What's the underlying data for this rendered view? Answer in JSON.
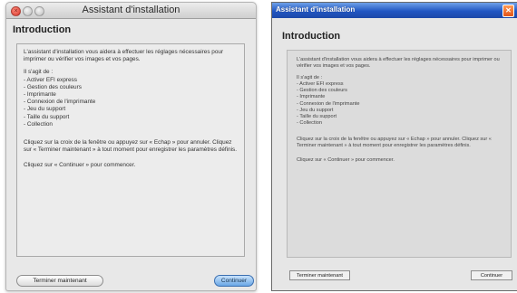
{
  "mac": {
    "title": "Assistant d'installation",
    "heading": "Introduction",
    "paragraph1": "L'assistant d'installation vous aidera à effectuer les réglages nécessaires pour imprimer ou vérifier vos images et vos pages.",
    "list_intro": "Il s'agit de :",
    "items": [
      "- Activer EFI express",
      "- Gestion des couleurs",
      "- Imprimante",
      "- Connexion de l'imprimante",
      "- Jeu du support",
      "- Taille du support",
      "- Collection"
    ],
    "paragraph2": "Cliquez sur la croix de la fenêtre ou appuyez sur « Echap » pour annuler. Cliquez sur « Terminer maintenant » à tout moment pour enregistrer les paramètres définis.",
    "paragraph3": "Cliquez sur « Continuer » pour commencer.",
    "finish_label": "Terminer maintenant",
    "continue_label": "Continuer",
    "close_glyph": "×"
  },
  "windows": {
    "title": "Assistant d'installation",
    "heading": "Introduction",
    "paragraph1": "L'assistant d'installation vous aidera à effectuer les réglages nécessaires pour imprimer ou vérifier vos images et vos pages.",
    "list_intro": "Il s'agit de :",
    "items": [
      "- Activer EFI express",
      "- Gestion des couleurs",
      "- Imprimante",
      "- Connexion de l'imprimante",
      "- Jeu du support",
      "- Taille du support",
      "- Collection"
    ],
    "paragraph2": "Cliquez sur la croix de la fenêtre ou appuyez sur « Echap » pour annuler. Cliquez sur « Terminer maintenant » à tout moment pour enregistrer les paramètres définis.",
    "paragraph3": "Cliquez sur « Continuer » pour commencer.",
    "finish_label": "Terminer maintenant",
    "continue_label": "Continuer",
    "close_glyph": "✕"
  },
  "icons": {
    "mac_close": "close-icon",
    "mac_minimize": "minimize-icon",
    "mac_zoom": "zoom-icon",
    "win_close": "close-icon"
  },
  "colors": {
    "mac_close": "#d6352a",
    "mac_default_button": "#6aa7e6",
    "win_titlebar": "#2156c3",
    "win_close": "#e2541a"
  }
}
